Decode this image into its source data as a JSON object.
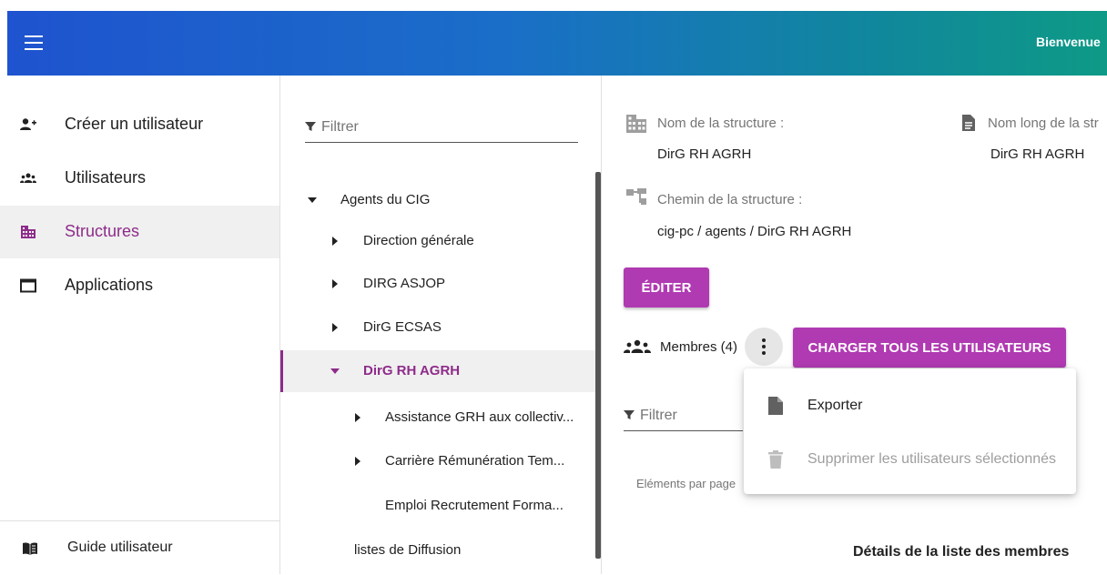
{
  "header": {
    "welcome": "Bienvenue"
  },
  "sidebar": {
    "items": [
      {
        "label": "Créer un utilisateur",
        "icon": "add-user-icon"
      },
      {
        "label": "Utilisateurs",
        "icon": "users-icon"
      },
      {
        "label": "Structures",
        "icon": "building-icon",
        "active": true
      },
      {
        "label": "Applications",
        "icon": "window-icon"
      }
    ],
    "guide": {
      "label": "Guide utilisateur",
      "icon": "book-icon"
    }
  },
  "tree": {
    "filter_placeholder": "Filtrer",
    "nodes": [
      {
        "label": "Agents du CIG",
        "caret": "down"
      },
      {
        "label": "Direction générale",
        "caret": "right"
      },
      {
        "label": "DIRG ASJOP",
        "caret": "right"
      },
      {
        "label": "DirG ECSAS",
        "caret": "right"
      },
      {
        "label": "DirG RH AGRH",
        "caret": "down",
        "active": true
      },
      {
        "label": "Assistance GRH aux collectiv...",
        "caret": "right"
      },
      {
        "label": "Carrière Rémunération Tem...",
        "caret": "right"
      },
      {
        "label": "Emploi Recrutement Forma...",
        "caret": "none"
      },
      {
        "label": "listes de Diffusion",
        "caret": "none"
      }
    ]
  },
  "detail": {
    "name_label": "Nom de la structure :",
    "name_value": "DirG RH AGRH",
    "long_name_label": "Nom long de la str",
    "long_name_value": "DirG RH AGRH",
    "path_label": "Chemin de la structure :",
    "path_value": "cig-pc / agents / DirG RH AGRH",
    "edit_button": "ÉDITER",
    "members_label": "Membres (4)",
    "load_button": "CHARGER TOUS LES UTILISATEURS",
    "filter_placeholder": "Filtrer",
    "per_page_label": "Eléments par page",
    "details_title": "Détails de la liste des membres"
  },
  "menu": {
    "items": [
      {
        "label": "Exporter",
        "icon": "file-icon",
        "disabled": false
      },
      {
        "label": "Supprimer les utilisateurs sélectionnés",
        "icon": "trash-icon",
        "disabled": true
      }
    ]
  },
  "colors": {
    "accent": "#b03ab2",
    "active_text": "#8e2c8a",
    "header_start": "#1f53cf",
    "header_end": "#0e9a86"
  }
}
